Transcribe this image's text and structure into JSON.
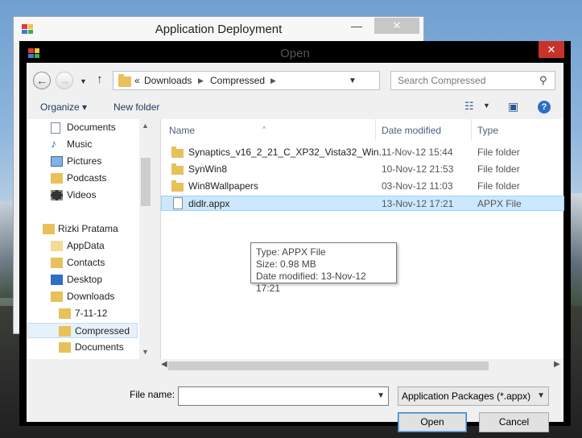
{
  "back_window": {
    "title": "Application Deployment",
    "minimize": "—",
    "close": "✕"
  },
  "dialog": {
    "title": "Open",
    "close": "✕",
    "address": {
      "overflow": "«",
      "segments": [
        "Downloads",
        "Compressed"
      ]
    },
    "search": {
      "placeholder": "Search Compressed"
    },
    "toolbar": {
      "organize": "Organize ▾",
      "new_folder": "New folder"
    },
    "nav": {
      "items": [
        {
          "label": "Documents"
        },
        {
          "label": "Music"
        },
        {
          "label": "Pictures"
        },
        {
          "label": "Podcasts"
        },
        {
          "label": "Videos"
        },
        {
          "label": "Rizki Pratama"
        },
        {
          "label": "AppData"
        },
        {
          "label": "Contacts"
        },
        {
          "label": "Desktop"
        },
        {
          "label": "Downloads"
        },
        {
          "label": "7-11-12"
        },
        {
          "label": "Compressed"
        },
        {
          "label": "Documents"
        }
      ]
    },
    "columns": {
      "name": "Name",
      "date": "Date modified",
      "type": "Type"
    },
    "files": [
      {
        "name": "Synaptics_v16_2_21_C_XP32_Vista32_Win...",
        "date": "11-Nov-12 15:44",
        "type": "File folder"
      },
      {
        "name": "SynWin8",
        "date": "10-Nov-12 21:53",
        "type": "File folder"
      },
      {
        "name": "Win8Wallpapers",
        "date": "03-Nov-12 11:03",
        "type": "File folder"
      },
      {
        "name": "didlr.appx",
        "date": "13-Nov-12 17:21",
        "type": "APPX File"
      }
    ],
    "tooltip": {
      "line1": "Type: APPX File",
      "line2": "Size: 0.98 MB",
      "line3": "Date modified: 13-Nov-12 17:21"
    },
    "file_name_label": "File name:",
    "file_name_value": "",
    "filter": "Application Packages (*.appx)",
    "open_button": "Open",
    "cancel_button": "Cancel"
  }
}
